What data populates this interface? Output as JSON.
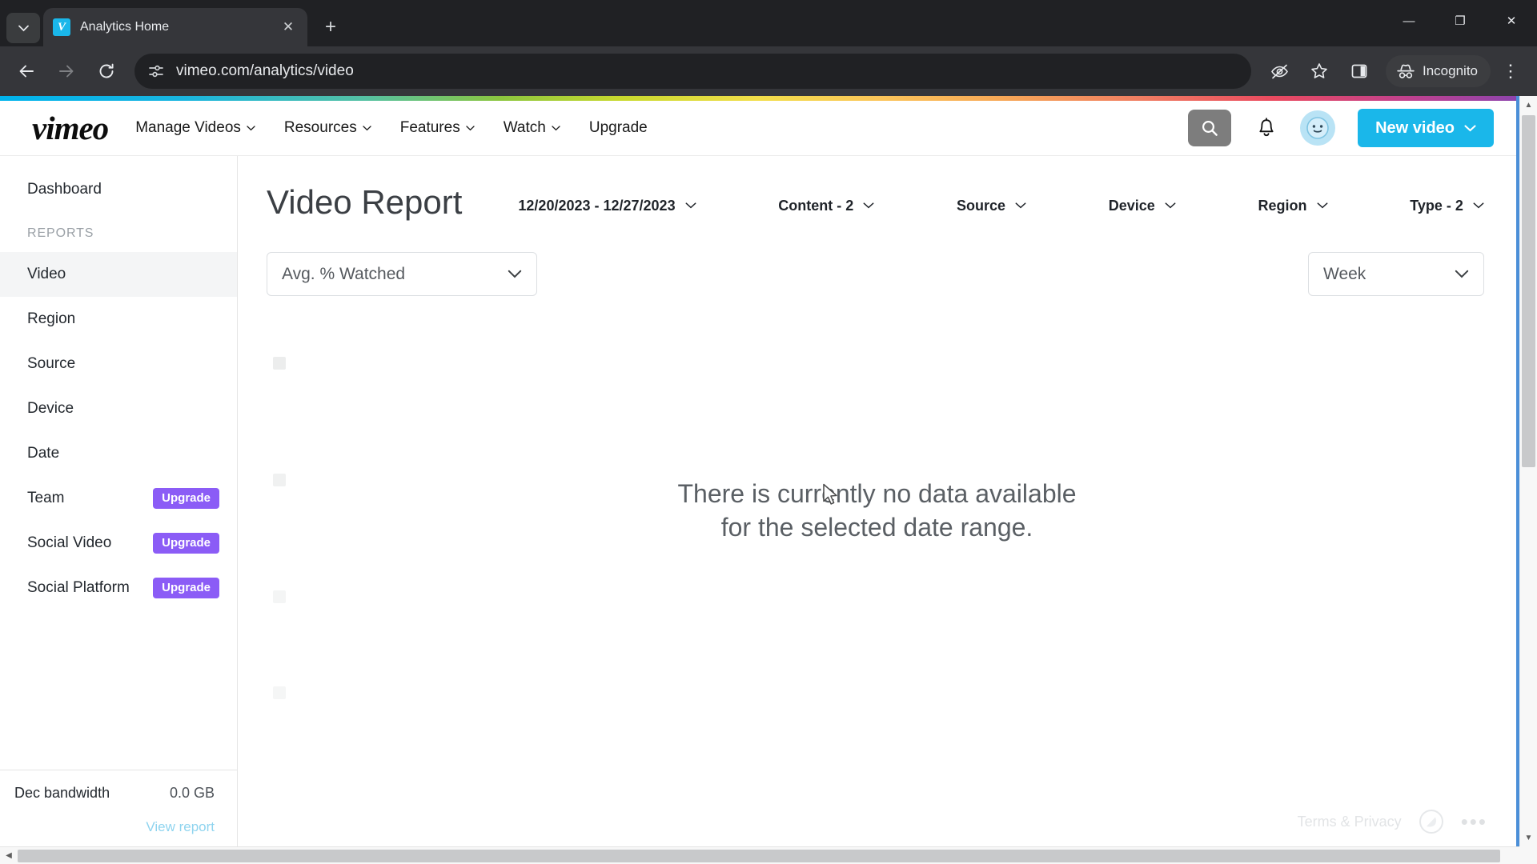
{
  "browser": {
    "tab_search_icon": "chevron-down-icon",
    "tab": {
      "title": "Analytics Home",
      "favicon": "vimeo-favicon",
      "favicon_glyph": "V",
      "close_glyph": "✕"
    },
    "new_tab_glyph": "+",
    "window_controls": {
      "minimize": "—",
      "maximize": "❐",
      "close": "✕"
    },
    "nav": {
      "back_glyph": "←",
      "forward_glyph": "→",
      "reload_glyph": "⟳"
    },
    "omnibox": {
      "url": "vimeo.com/analytics/video",
      "site_info_icon": "page-settings-icon"
    },
    "toolbar_right": {
      "tracking_protection_icon": "eye-slash-icon",
      "bookmark_icon": "star-icon",
      "side_panel_icon": "side-panel-icon",
      "incognito_label": "Incognito",
      "incognito_icon": "incognito-hat-icon",
      "menu_glyph": "⋮"
    }
  },
  "site": {
    "logo_text": "vimeo",
    "nav_items": [
      {
        "label": "Manage Videos",
        "has_caret": true
      },
      {
        "label": "Resources",
        "has_caret": true
      },
      {
        "label": "Features",
        "has_caret": true
      },
      {
        "label": "Watch",
        "has_caret": true
      },
      {
        "label": "Upgrade",
        "has_caret": false
      }
    ],
    "search_icon": "search-icon",
    "notifications_icon": "bell-icon",
    "avatar_icon": "user-avatar-icon",
    "new_video_label": "New video",
    "accent_color": "#1ab7ea",
    "upgrade_badge_color": "#8b5cf6"
  },
  "sidebar": {
    "dashboard_label": "Dashboard",
    "section_label": "REPORTS",
    "items": [
      {
        "label": "Video",
        "badge": "",
        "active": true
      },
      {
        "label": "Region",
        "badge": "",
        "active": false
      },
      {
        "label": "Source",
        "badge": "",
        "active": false
      },
      {
        "label": "Device",
        "badge": "",
        "active": false
      },
      {
        "label": "Date",
        "badge": "",
        "active": false
      },
      {
        "label": "Team",
        "badge": "Upgrade",
        "active": false
      },
      {
        "label": "Social Video",
        "badge": "Upgrade",
        "active": false
      },
      {
        "label": "Social Platform",
        "badge": "Upgrade",
        "active": false
      }
    ],
    "bandwidth_label": "Dec bandwidth",
    "bandwidth_value": "0.0 GB",
    "view_report_label": "View report"
  },
  "main": {
    "title": "Video Report",
    "filters": [
      {
        "label": "12/20/2023 - 12/27/2023",
        "caret": "⌄"
      },
      {
        "label": "Content - 2",
        "caret": "⌄"
      },
      {
        "label": "Source",
        "caret": "⌄"
      },
      {
        "label": "Device",
        "caret": "⌄"
      },
      {
        "label": "Region",
        "caret": "⌄"
      },
      {
        "label": "Type - 2",
        "caret": "⌄"
      }
    ],
    "metric_select": {
      "value": "Avg. % Watched",
      "caret": "⌄"
    },
    "period_select": {
      "value": "Week",
      "caret": "⌄"
    },
    "empty_state_line1": "There is currently no data available",
    "empty_state_line2": "for the selected date range."
  },
  "chart_data": {
    "type": "line",
    "title": "Avg. % Watched",
    "xlabel": "",
    "ylabel": "Avg. % Watched",
    "granularity": "Week",
    "date_range": "12/20/2023 - 12/27/2023",
    "categories": [],
    "values": [],
    "series": [],
    "grid": false,
    "legend": "none",
    "empty": true,
    "empty_message": "There is currently no data available for the selected date range."
  },
  "footer": {
    "terms_label": "Terms & Privacy",
    "accessibility_icon": "accessibility-circle-icon",
    "more_glyph": "•••"
  },
  "scrollbars": {
    "v_up_glyph": "▲",
    "v_down_glyph": "▼",
    "h_left_glyph": "◀",
    "h_right_glyph": "▶"
  }
}
